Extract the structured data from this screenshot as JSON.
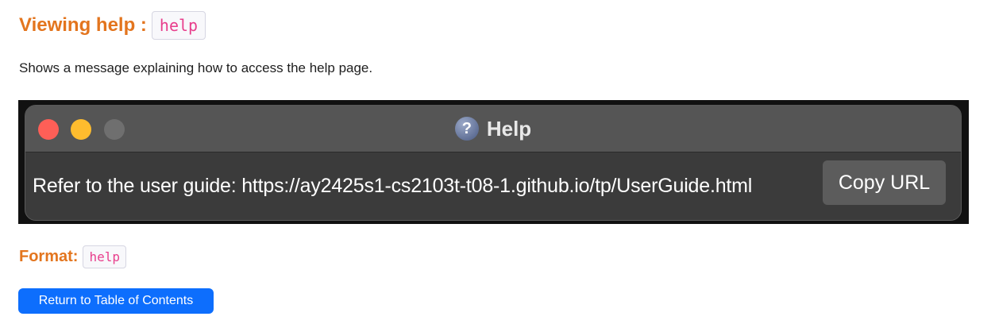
{
  "section": {
    "heading_label": "Viewing help :",
    "heading_code": "help",
    "description": "Shows a message explaining how to access the help page."
  },
  "help_window": {
    "title": "Help",
    "title_icon": "?",
    "message": "Refer to the user guide: https://ay2425s1-cs2103t-t08-1.github.io/tp/UserGuide.html",
    "copy_button": "Copy URL"
  },
  "format": {
    "label": "Format:",
    "code": "help"
  },
  "navigation": {
    "toc_button": "Return to Table of Contents"
  },
  "colors": {
    "heading": "#e3751e",
    "code_text": "#e83e8c",
    "button_primary": "#0d6efd",
    "traffic_close": "#fe5f57",
    "traffic_minimize": "#febc2e"
  }
}
